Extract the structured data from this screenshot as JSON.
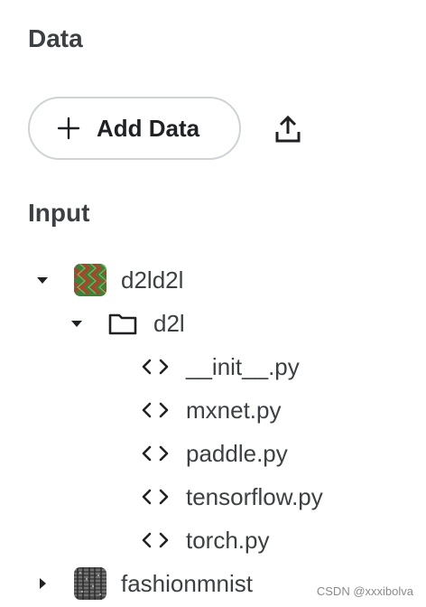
{
  "data_section": {
    "title": "Data",
    "add_button_label": "Add Data",
    "add_icon": "plus-icon",
    "upload_icon": "upload-icon"
  },
  "input_section": {
    "title": "Input",
    "datasets": [
      {
        "name": "d2ld2l",
        "expanded": true,
        "thumb_icon": "dataset-thumbnail-zigzag",
        "folders": [
          {
            "name": "d2l",
            "expanded": true,
            "icon": "folder-icon",
            "files": [
              {
                "name": "__init__.py",
                "icon": "code-icon"
              },
              {
                "name": "mxnet.py",
                "icon": "code-icon"
              },
              {
                "name": "paddle.py",
                "icon": "code-icon"
              },
              {
                "name": "tensorflow.py",
                "icon": "code-icon"
              },
              {
                "name": "torch.py",
                "icon": "code-icon"
              }
            ]
          }
        ]
      },
      {
        "name": "fashionmnist",
        "expanded": false,
        "thumb_icon": "dataset-thumbnail-texture"
      }
    ]
  },
  "watermark": "CSDN @xxxibolva",
  "colors": {
    "thumb_green": "#4a8f3c",
    "thumb_red": "#c0392b",
    "text": "#3c4043",
    "border": "#cfd2d6"
  }
}
